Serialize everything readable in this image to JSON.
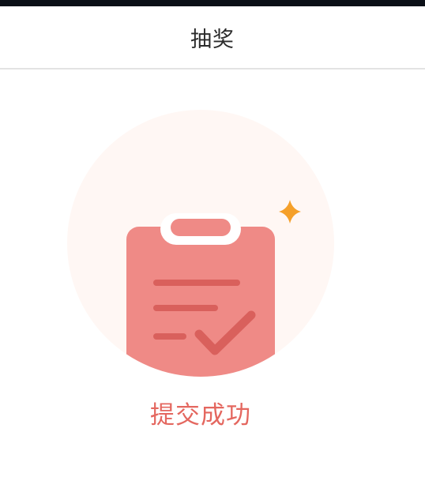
{
  "nav": {
    "title": "抽奖"
  },
  "result": {
    "message": "提交成功"
  },
  "icons": {
    "status_icon": "clipboard-check-icon",
    "sparkle_icon": "sparkle-icon"
  },
  "colors": {
    "accent": "#e4675f",
    "clipboard": "#ef8a86",
    "clipboard_lines": "#d9605c",
    "circle_bg": "#fff7f4",
    "sparkle": "#f5a02a"
  }
}
